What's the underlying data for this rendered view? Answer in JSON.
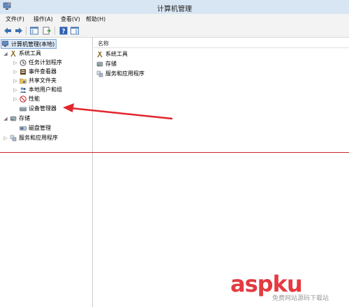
{
  "window": {
    "title": "计算机管理"
  },
  "menu": {
    "file": "文件(F)",
    "action": "操作(A)",
    "view": "查看(V)",
    "help": "帮助(H)"
  },
  "tree": {
    "root": "计算机管理(本地)",
    "system_tools": "系统工具",
    "task_scheduler": "任务计划程序",
    "event_viewer": "事件查看器",
    "shared_folders": "共享文件夹",
    "local_users": "本地用户和组",
    "performance": "性能",
    "device_manager": "设备管理器",
    "storage": "存储",
    "disk_management": "磁盘管理",
    "services_apps": "服务和应用程序"
  },
  "list": {
    "column_name": "名称",
    "items": [
      "系统工具",
      "存储",
      "服务和应用程序"
    ]
  },
  "watermark": {
    "text": "aspku",
    "sub": "免费网站源码下载站"
  },
  "colors": {
    "annotation_red": "#e2252d",
    "selection": "#dbe9f8"
  }
}
